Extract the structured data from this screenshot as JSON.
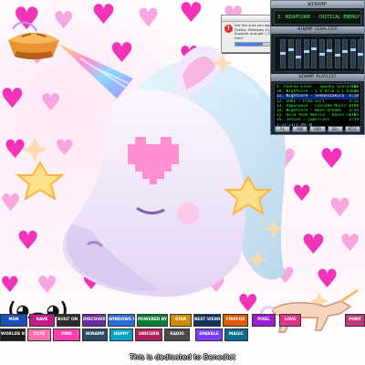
{
  "colors": {
    "hot_pink": "#f233b8",
    "light_pink": "#f7a6df",
    "screen_green": "#33ff33",
    "selection_blue": "#0a2a7a"
  },
  "icons": [
    "pie-icon",
    "heart-icon",
    "star-icon",
    "sparkle-icon",
    "warning-icon"
  ],
  "player": {
    "title": "WINAMP",
    "now_playing": "3. NIGHTCORE - CRITICAL ENERGY (4:18) ***",
    "eq_title": "WINAMP EQUALIZER",
    "eq_levels": [
      0.55,
      0.7,
      0.4,
      0.6,
      0.75,
      0.5,
      0.65,
      0.45,
      0.6,
      0.7,
      0.5
    ],
    "playlist_title": "WINAMP PLAYLIST",
    "playlist": [
      {
        "n": "9.",
        "title": "Andrew Elver - Spooky Scary Skeletons",
        "time": "3:02"
      },
      {
        "n": "10.",
        "title": "Nightcore - I'm Blue a I'm Good",
        "time": "3:21"
      },
      {
        "n": "11.",
        "title": "Nightcore - Senbonzakura",
        "time": "4:28"
      },
      {
        "n": "12.",
        "title": "LOAL - Pika Girl",
        "time": "3:12"
      },
      {
        "n": "13.",
        "title": "Vaporwave - Cascade Music (Trap Remix)",
        "time": "3:27"
      },
      {
        "n": "14.",
        "title": "Nightcore - Neon Dreams",
        "time": "3:54"
      },
      {
        "n": "15.",
        "title": "Hold Yeah Noella - Dance Till You're Dead",
        "time": "4:04"
      },
      {
        "n": "16.",
        "title": "Jessie - Capelless",
        "time": "2:59"
      }
    ],
    "playlist_selected": 2,
    "total_time": "1:23:11/1:49:34",
    "controls": [
      "PL",
      "ADD",
      "REM",
      "SEL",
      "MISC"
    ]
  },
  "dialog": {
    "text": "Are You sure you want to upgrade Firefox, Windows 10, Internet Explorer and get 1,500 Viruses for free?",
    "progress": 0.45,
    "cancel_label": "No",
    "ok_label": "Ok"
  },
  "face_text": "(◕︵◕)",
  "badges": [
    "MSN",
    "RAVE",
    "BUILT ON A",
    "DISCOVER",
    "WINDOWS 98",
    "POWERED BY",
    "STAR",
    "BEST VIEWED",
    "FIREFOX",
    "PIXEL",
    "LOVE",
    "WORLDS WIDE WEB",
    "CUTE",
    "PINK",
    "WINAMP",
    "HAPPY",
    "UNICORN",
    "RADIO",
    "SPARKLE",
    "MAGIC",
    "PONY"
  ],
  "caption": "This is dedicated to Benedict"
}
